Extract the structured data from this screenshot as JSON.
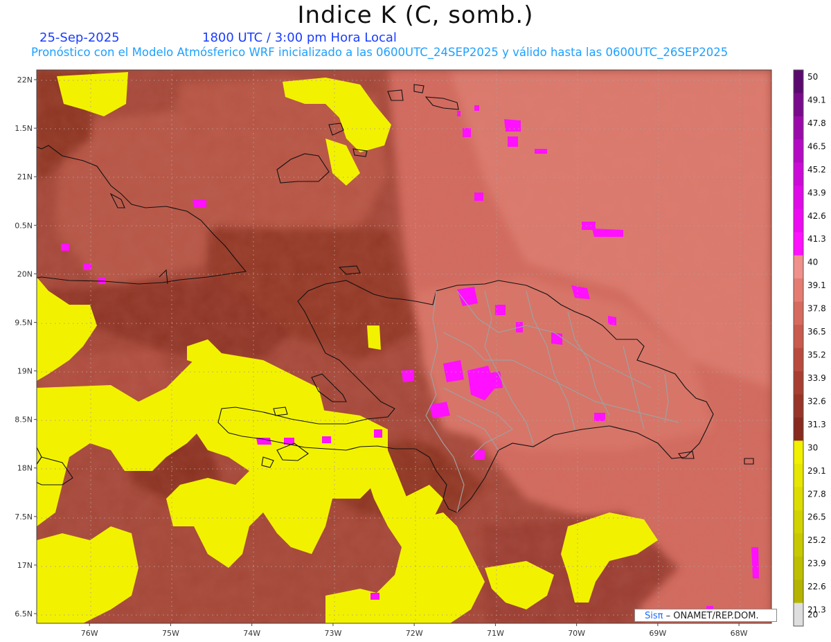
{
  "header": {
    "title": "Indice K (C, somb.)",
    "date": "25-Sep-2025",
    "time": "1800 UTC / 3:00 pm Hora Local",
    "subtitle": "Pronóstico con el Modelo Atmósferico WRF inicializado a las 0600UTC_24SEP2025 y válido hasta las  0600UTC_26SEP2025"
  },
  "axes": {
    "lon_labels": [
      "76W",
      "75W",
      "74W",
      "73W",
      "72W",
      "71W",
      "70W",
      "69W",
      "68W"
    ],
    "lon_values": [
      -76,
      -75,
      -74,
      -73,
      -72,
      -71,
      -70,
      -69,
      -68
    ],
    "lat_labels": [
      "22N",
      "1.5N",
      "21N",
      "0.5N",
      "20N",
      "9.5N",
      "19N",
      "8.5N",
      "18N",
      "7.5N",
      "17N",
      "6.5N"
    ],
    "lat_values": [
      22,
      21.5,
      21,
      20.5,
      20,
      19.5,
      19,
      18.5,
      18,
      17.5,
      17,
      16.5
    ],
    "lon_range": [
      -76.65,
      -67.6
    ],
    "lat_range": [
      16.4,
      22.1
    ]
  },
  "colorbar": {
    "labels": [
      "50",
      "49.1",
      "47.8",
      "46.5",
      "45.2",
      "43.9",
      "42.6",
      "41.3",
      "40",
      "39.1",
      "37.8",
      "36.5",
      "35.2",
      "33.9",
      "32.6",
      "31.3",
      "30",
      "29.1",
      "27.8",
      "26.5",
      "25.2",
      "23.9",
      "22.6",
      "21.3",
      "20"
    ],
    "colors": [
      "#5a0a6e",
      "#7a0a8c",
      "#9a0aaa",
      "#b40ac4",
      "#cc0ad8",
      "#e00ae8",
      "#ee0af2",
      "#ff10ff",
      "#f0908a",
      "#e47c72",
      "#d66a5e",
      "#c85a4e",
      "#b84a3e",
      "#a83e32",
      "#983428",
      "#882a1e",
      "#f0f000",
      "#e6e600",
      "#dcdc00",
      "#d2d200",
      "#c8c800",
      "#bebe00",
      "#b4b400",
      "#dedede"
    ]
  },
  "credit": {
    "logo": "Sisπ",
    "text": "– ONAMET/REP.DOM."
  },
  "colors": {
    "background_low": "#8a3220",
    "background_mid": "#b65a4a",
    "background_high": "#d97468",
    "yellow": "#f2f200",
    "magenta": "#ff10ff",
    "coast": "#111111",
    "provinces": "#a0a0a0"
  }
}
